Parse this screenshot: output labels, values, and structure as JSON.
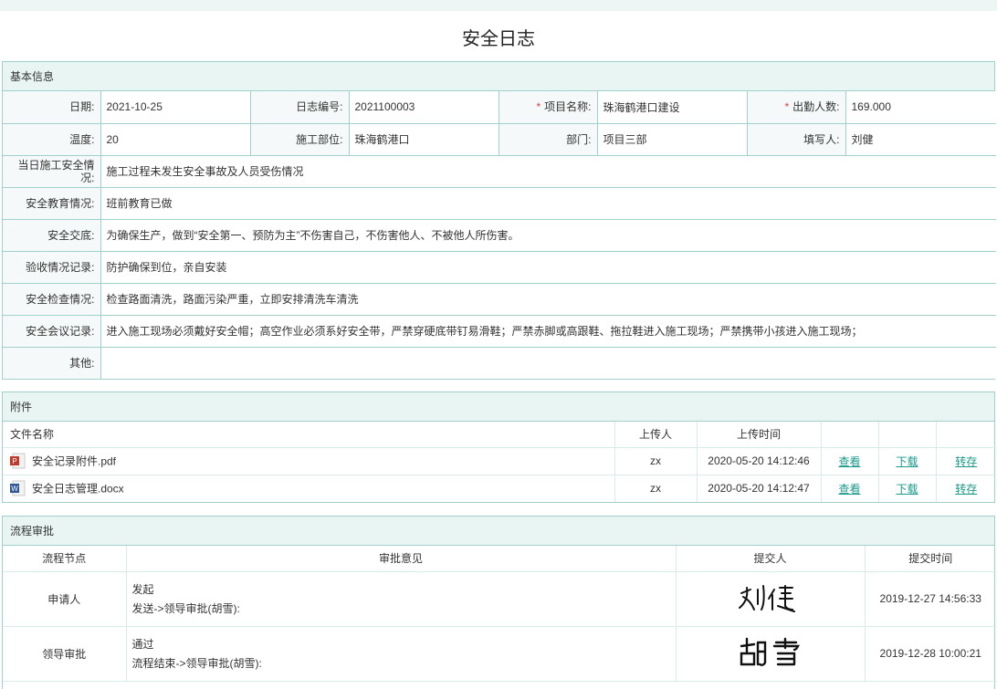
{
  "page": {
    "title": "安全日志"
  },
  "basic": {
    "header": "基本信息",
    "row1": [
      {
        "label": "日期:",
        "value": "2021-10-25"
      },
      {
        "label": "日志编号:",
        "value": "2021100003"
      },
      {
        "label": "项目名称:",
        "value": "珠海鹤港口建设",
        "required": true
      },
      {
        "label": "出勤人数:",
        "value": "169.000",
        "required": true
      }
    ],
    "row2": [
      {
        "label": "温度:",
        "value": "20"
      },
      {
        "label": "施工部位:",
        "value": "珠海鹤港口"
      },
      {
        "label": "部门:",
        "value": "项目三部"
      },
      {
        "label": "填写人:",
        "value": "刘健"
      }
    ],
    "rows": [
      {
        "label": "当日施工安全情况:",
        "value": "施工过程未发生安全事故及人员受伤情况"
      },
      {
        "label": "安全教育情况:",
        "value": "班前教育已做"
      },
      {
        "label": "安全交底:",
        "value": "为确保生产，做到“安全第一、预防为主”不伤害自己，不伤害他人、不被他人所伤害。"
      },
      {
        "label": "验收情况记录:",
        "value": "防护确保到位，亲自安装"
      },
      {
        "label": "安全检查情况:",
        "value": "检查路面清洗，路面污染严重，立即安排清洗车清洗"
      },
      {
        "label": "安全会议记录:",
        "value": "进入施工现场必须戴好安全帽；高空作业必须系好安全带，严禁穿硬底带钉易滑鞋；严禁赤脚或高跟鞋、拖拉鞋进入施工现场；严禁携带小孩进入施工现场；"
      },
      {
        "label": "其他:",
        "value": ""
      }
    ]
  },
  "attachments": {
    "header": "附件",
    "columns": {
      "name": "文件名称",
      "uploader": "上传人",
      "time": "上传时间"
    },
    "files": [
      {
        "icon": "pdf-file-icon",
        "name": "安全记录附件.pdf",
        "uploader": "zx",
        "time": "2020-05-20 14:12:46",
        "view": "查看",
        "download": "下载",
        "save": "转存"
      },
      {
        "icon": "word-file-icon",
        "name": "安全日志管理.docx",
        "uploader": "zx",
        "time": "2020-05-20 14:12:47",
        "view": "查看",
        "download": "下载",
        "save": "转存"
      }
    ]
  },
  "workflow": {
    "header": "流程审批",
    "columns": {
      "node": "流程节点",
      "opinion": "审批意见",
      "submitter": "提交人",
      "time": "提交时间"
    },
    "rows": [
      {
        "node": "申请人",
        "opinion1": "发起",
        "opinion2": "发送->领导审批(胡雪):",
        "signature": "刘健",
        "time": "2019-12-27 14:56:33"
      },
      {
        "node": "领导审批",
        "opinion1": "通过",
        "opinion2": "流程结束->领导审批(胡雪):",
        "signature": "胡雪",
        "time": "2019-12-28 10:00:21"
      }
    ]
  },
  "colors": {
    "border": "#9fd0cb",
    "header_bg": "#e8f5f3",
    "link": "#1a9a8a",
    "required": "#e4393c"
  }
}
